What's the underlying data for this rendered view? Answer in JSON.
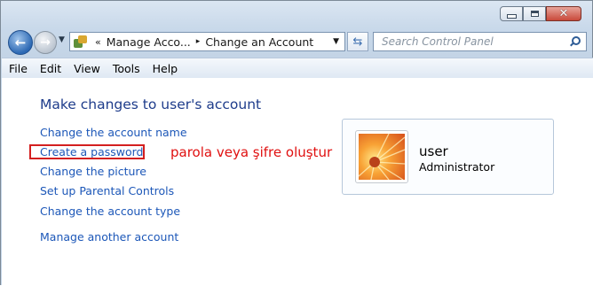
{
  "window": {
    "controls": {
      "minimize": "minimize",
      "maximize": "maximize",
      "close": "✕"
    }
  },
  "nav": {
    "back_icon": "arrow-left-icon",
    "forward_icon": "arrow-right-icon"
  },
  "address": {
    "prefix": "«",
    "crumbs": [
      "Manage Acco...",
      "Change an Account"
    ],
    "separator": "▸"
  },
  "search": {
    "placeholder": "Search Control Panel"
  },
  "menubar": {
    "items": [
      "File",
      "Edit",
      "View",
      "Tools",
      "Help"
    ]
  },
  "main": {
    "title": "Make changes to user's account",
    "tasks": [
      "Change the account name",
      "Create a password",
      "Change the picture",
      "Set up Parental Controls",
      "Change the account type"
    ],
    "other_task": "Manage another account",
    "annotation": "parola veya şifre oluştur",
    "annotation_color": "#e01010",
    "highlight_color": "#d41f1f"
  },
  "account": {
    "name": "user",
    "role": "Administrator"
  },
  "colors": {
    "link": "#1c57b8",
    "title": "#1e3c8b"
  }
}
